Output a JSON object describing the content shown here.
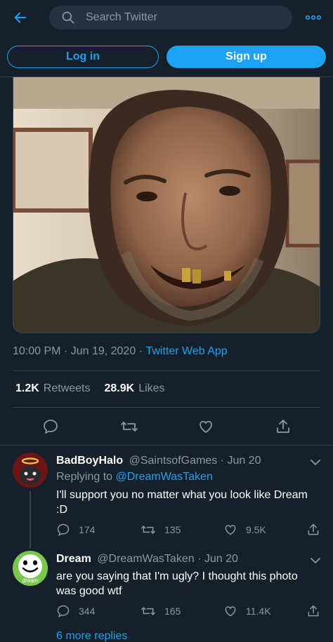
{
  "header": {
    "back_icon": "arrow-left-icon",
    "search_placeholder": "Search Twitter",
    "more_icon": "more-dots-icon"
  },
  "auth": {
    "login_label": "Log in",
    "signup_label": "Sign up"
  },
  "tweet": {
    "time": "10:00 PM",
    "date": "Jun 19, 2020",
    "source": "Twitter Web App",
    "retweets_count": "1.2K",
    "retweets_label": "Retweets",
    "likes_count": "28.9K",
    "likes_label": "Likes"
  },
  "replies": [
    {
      "display_name": "BadBoyHalo",
      "handle": "@SaintsofGames",
      "date": "Jun 20",
      "replying_prefix": "Replying to",
      "replying_to": "@DreamWasTaken",
      "text": "I'll support you no matter what you look like Dream :D",
      "reply_count": "174",
      "retweet_count": "135",
      "like_count": "9.5K"
    },
    {
      "display_name": "Dream",
      "handle": "@DreamWasTaken",
      "date": "Jun 20",
      "text": "are you saying that I'm ugly? I thought this photo was good wtf",
      "reply_count": "344",
      "retweet_count": "165",
      "like_count": "11.4K",
      "avatar_text": "dream"
    }
  ],
  "more_replies": "6 more replies",
  "colors": {
    "background": "#15202b",
    "accent": "#1da1f2",
    "muted": "#8899a6",
    "border": "#38444d"
  }
}
